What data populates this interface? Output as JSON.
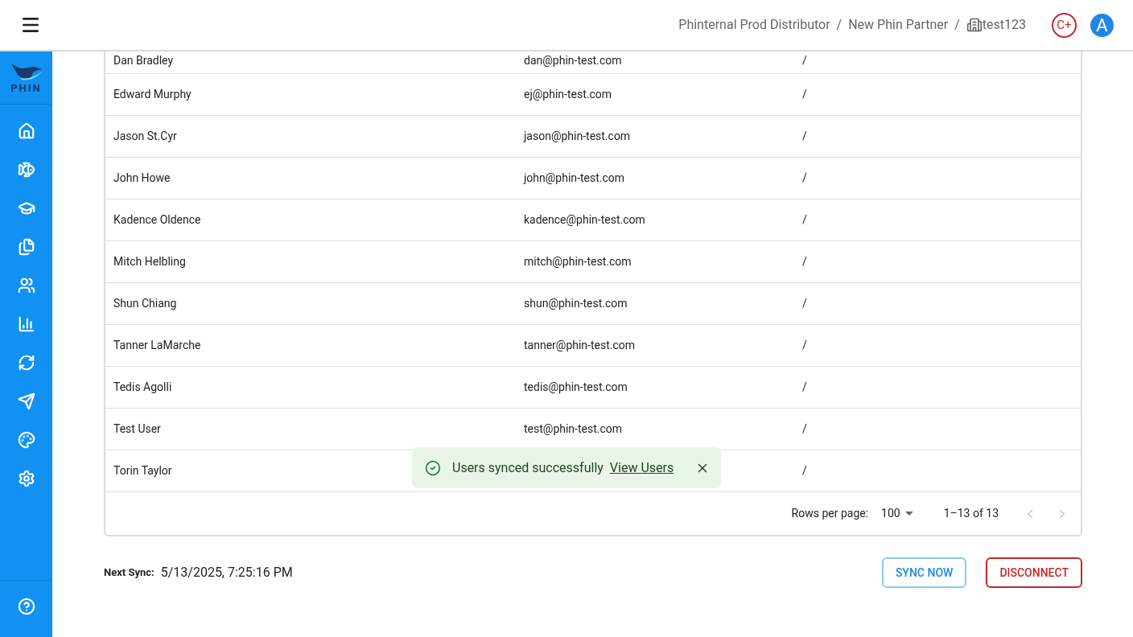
{
  "header": {
    "breadcrumbs": [
      {
        "label": "Phinternal Prod Distributor",
        "kind": "text"
      },
      {
        "label": "New Phin Partner",
        "kind": "text"
      },
      {
        "label": "test123",
        "kind": "building"
      }
    ],
    "separator": "/",
    "badge": "C+",
    "avatar": "A"
  },
  "sidebar": {
    "logo": "PHIN",
    "items": [
      {
        "kind": "home"
      },
      {
        "kind": "fish"
      },
      {
        "kind": "education"
      },
      {
        "kind": "files"
      },
      {
        "kind": "users"
      },
      {
        "kind": "chart"
      },
      {
        "kind": "sync"
      },
      {
        "kind": "send"
      },
      {
        "kind": "palette"
      },
      {
        "kind": "settings"
      }
    ],
    "help": {
      "kind": "help"
    }
  },
  "table": {
    "rows": [
      {
        "name": "Dan Bradley",
        "email": "dan@phin-test.com",
        "column_3": "/"
      },
      {
        "name": "Edward Murphy",
        "email": "ej@phin-test.com",
        "column_3": "/"
      },
      {
        "name": "Jason St.Cyr",
        "email": "jason@phin-test.com",
        "column_3": "/"
      },
      {
        "name": "John Howe",
        "email": "john@phin-test.com",
        "column_3": "/"
      },
      {
        "name": "Kadence Oldence",
        "email": "kadence@phin-test.com",
        "column_3": "/"
      },
      {
        "name": "Mitch Helbling",
        "email": "mitch@phin-test.com",
        "column_3": "/"
      },
      {
        "name": "Shun Chiang",
        "email": "shun@phin-test.com",
        "column_3": "/"
      },
      {
        "name": "Tanner LaMarche",
        "email": "tanner@phin-test.com",
        "column_3": "/"
      },
      {
        "name": "Tedis Agolli",
        "email": "tedis@phin-test.com",
        "column_3": "/"
      },
      {
        "name": "Test User",
        "email": "test@phin-test.com",
        "column_3": "/"
      },
      {
        "name": "Torin Taylor",
        "column_3": "/"
      }
    ],
    "pagination": {
      "rows_per_page_label": "Rows per page:",
      "rows_per_page": "100",
      "range": "1–13 of 13",
      "prev_disabled": true,
      "next_disabled": true
    }
  },
  "next_sync": {
    "label": "Next Sync:",
    "value": "5/13/2025, 7:25:16 PM"
  },
  "buttons": [
    {
      "label": "SYNC NOW",
      "kind": "primary"
    },
    {
      "label": "DISCONNECT",
      "kind": "danger"
    }
  ],
  "toast": {
    "message": "Users synced successfully",
    "link": "View Users"
  }
}
